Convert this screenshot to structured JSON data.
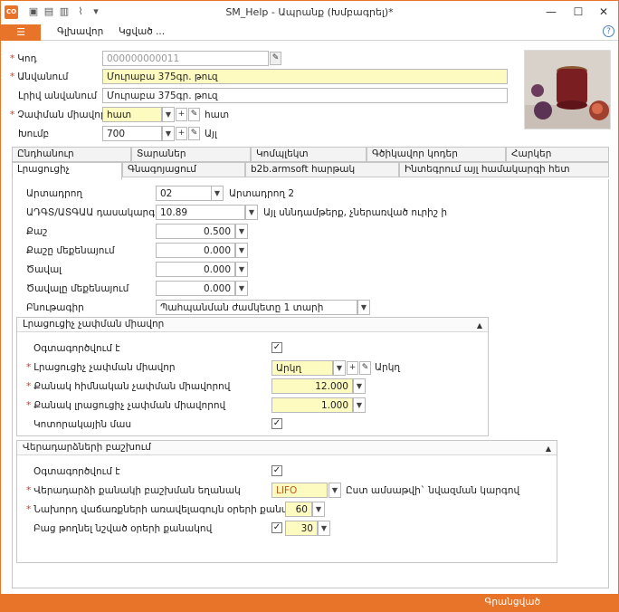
{
  "titlebar": {
    "title": "SM_Help - Ապրանք (Խմբագրել)*",
    "logo": "CO"
  },
  "menu": {
    "main_button": "☰",
    "items": [
      "Գլխավոր",
      "Կցված ..."
    ],
    "help": "?"
  },
  "header": {
    "code_label": "Կոդ",
    "code_value": "000000000011",
    "name_label": "Անվանում",
    "name_value": "Մուրաբա 375գր. թուզ",
    "fullname_label": "Լրիվ անվանում",
    "fullname_value": "Մուրաբա 375գր. թուզ",
    "unit_label": "Չափման միավոր",
    "unit_value": "հատ",
    "unit_text": "հատ",
    "group_label": "Խումբ",
    "group_value": "700",
    "group_text": "Այլ"
  },
  "tabs": {
    "row1": [
      "Ընդհանուր",
      "Տարաներ",
      "Կոմպլեկտ",
      "Գծիկավոր կոդեր",
      "Հարկեր"
    ],
    "row2": [
      "Լրացուցիչ",
      "Գնագոյացում",
      "b2b.armsoft հարթակ",
      "Ինտեգրում այլ համակարգի հետ"
    ]
  },
  "extra": {
    "producer_label": "Արտադրող",
    "producer_value": "02",
    "producer_text": "Արտադրող 2",
    "classifier_label": "ԱԴԳՏ/ԱՏԳԱԱ դասակարգիչ",
    "classifier_value": "10.89",
    "classifier_text": "Այլ սննդամթերք, չներառված ուրիշ ի",
    "weight_label": "Քաշ",
    "weight_value": "0.500",
    "weight_unit_label": "Քաշը մեքենայում",
    "weight_unit_value": "0.000",
    "volume_label": "Ծավալ",
    "volume_value": "0.000",
    "volume_unit_label": "Ծավալը մեքենայում",
    "volume_unit_value": "0.000",
    "nature_label": "Բնութագիր",
    "nature_value": "Պահպանման ժամկետը 1 տարի"
  },
  "unit_group": {
    "title": "Լրացուցիչ չափման միավոր",
    "used_label": "Օգտագործվում է",
    "unit_label": "Լրացուցիչ չափման միավոր",
    "unit_value": "Արկղ",
    "unit_text": "Արկղ",
    "base_qty_label": "Քանակ հիմնական չափման միավորով",
    "base_qty_value": "12.000",
    "extra_qty_label": "Քանակ լրացուցիչ չափման միավորով",
    "extra_qty_value": "1.000",
    "fractional_label": "Կոտորակային մաս"
  },
  "resale_group": {
    "title": "Վերադարձների բաշխում",
    "used_label": "Օգտագործվում է",
    "method_label": "Վերադարձի քանակի բաշխման եղանակ",
    "method_value": "LIFO",
    "method_text": "Ըստ ամսաթվի` նվազման կարգով",
    "days_label": "Նախորդ վաճառքների առավելագույն օրերի քանակ",
    "days_value": "60",
    "skip_label": "Բաց թողնել նշված օրերի քանակով",
    "skip_value": "30"
  },
  "status": {
    "text": "Գրանցված"
  },
  "colors": {
    "accent": "#e8742a",
    "required_fill": "#fefbc0"
  }
}
